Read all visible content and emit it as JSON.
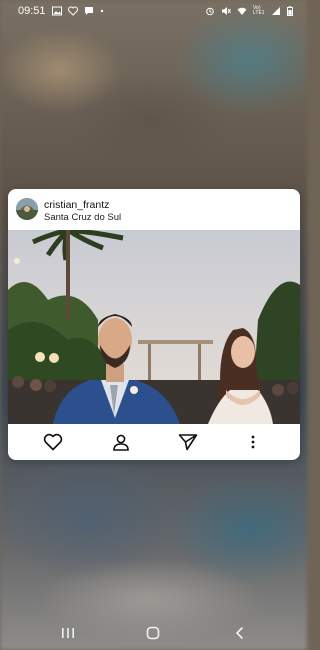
{
  "status_bar": {
    "time": "09:51",
    "left_icons": [
      "gallery-icon",
      "heart-outline-icon",
      "chat-icon",
      "dot-icon"
    ],
    "right_icons": [
      "alarm-icon",
      "mute-icon",
      "wifi-icon",
      "volte-icon",
      "signal-icon",
      "battery-icon"
    ],
    "volte_label": "Vo) LTE1"
  },
  "post": {
    "username": "cristian_frantz",
    "location": "Santa Cruz do Sul",
    "photo_caption": "",
    "actions": [
      "heart-icon",
      "profile-icon",
      "send-icon",
      "more-vertical-icon"
    ]
  },
  "nav": {
    "buttons": [
      "recent-apps-icon",
      "home-icon",
      "back-icon"
    ]
  }
}
